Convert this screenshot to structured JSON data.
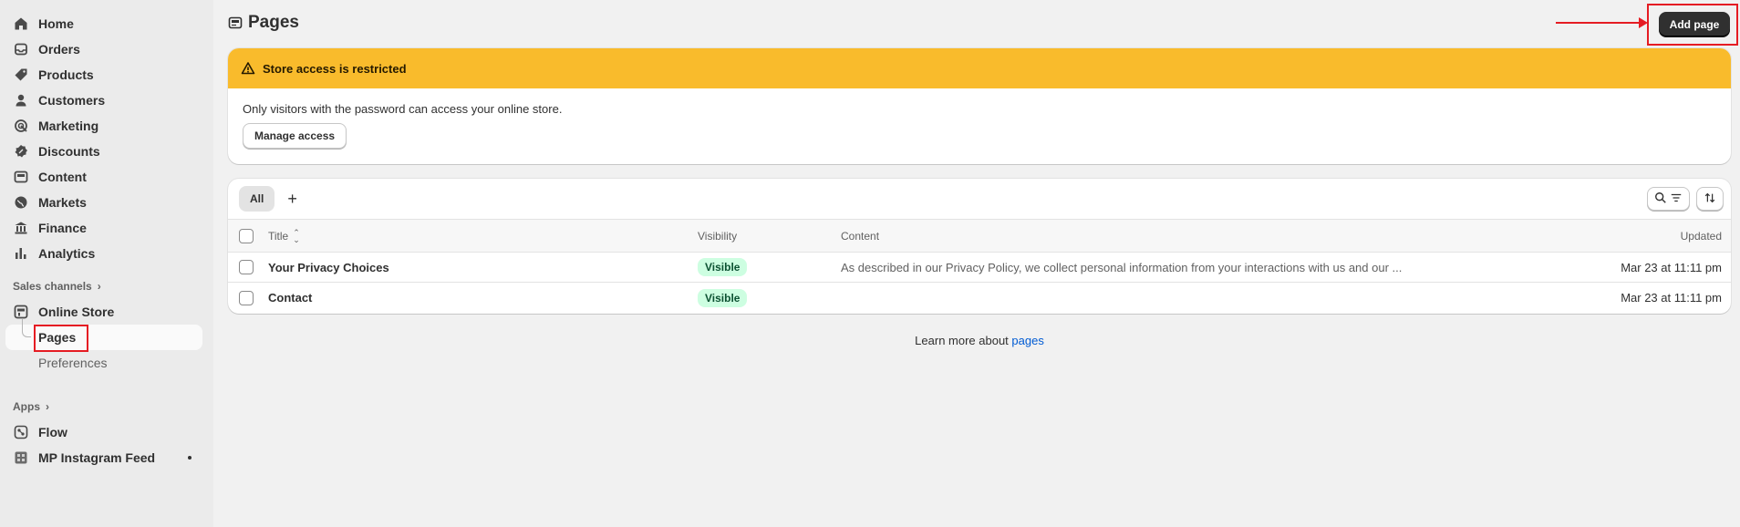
{
  "sidebar": {
    "items": [
      {
        "label": "Home",
        "icon": "home-icon"
      },
      {
        "label": "Orders",
        "icon": "inbox-icon"
      },
      {
        "label": "Products",
        "icon": "tag-icon"
      },
      {
        "label": "Customers",
        "icon": "person-icon"
      },
      {
        "label": "Marketing",
        "icon": "target-icon"
      },
      {
        "label": "Discounts",
        "icon": "discount-icon"
      },
      {
        "label": "Content",
        "icon": "image-icon"
      },
      {
        "label": "Markets",
        "icon": "globe-icon"
      },
      {
        "label": "Finance",
        "icon": "bank-icon"
      },
      {
        "label": "Analytics",
        "icon": "bar-chart-icon"
      }
    ],
    "sales_channels_label": "Sales channels",
    "online_store_label": "Online Store",
    "pages_label": "Pages",
    "preferences_label": "Preferences",
    "apps_label": "Apps",
    "flow_label": "Flow",
    "instagram_label": "MP Instagram Feed"
  },
  "header": {
    "title": "Pages",
    "add_button": "Add page"
  },
  "banner": {
    "title": "Store access is restricted",
    "text": "Only visitors with the password can access your online store.",
    "button": "Manage access"
  },
  "table": {
    "tab_all": "All",
    "tab_add": "+",
    "columns": {
      "title": "Title",
      "visibility": "Visibility",
      "content": "Content",
      "updated": "Updated"
    },
    "rows": [
      {
        "title": "Your Privacy Choices",
        "visibility": "Visible",
        "content": "As described in our Privacy Policy, we collect personal information from your interactions with us and our ...",
        "updated": "Mar 23 at 11:11 pm"
      },
      {
        "title": "Contact",
        "visibility": "Visible",
        "content": "",
        "updated": "Mar 23 at 11:11 pm"
      }
    ]
  },
  "footer": {
    "prefix": "Learn more about ",
    "link": "pages"
  },
  "colors": {
    "banner": "#f9bb2c",
    "badge_bg": "#cdfee1",
    "link": "#005bd3",
    "annotation": "#e51c23"
  }
}
